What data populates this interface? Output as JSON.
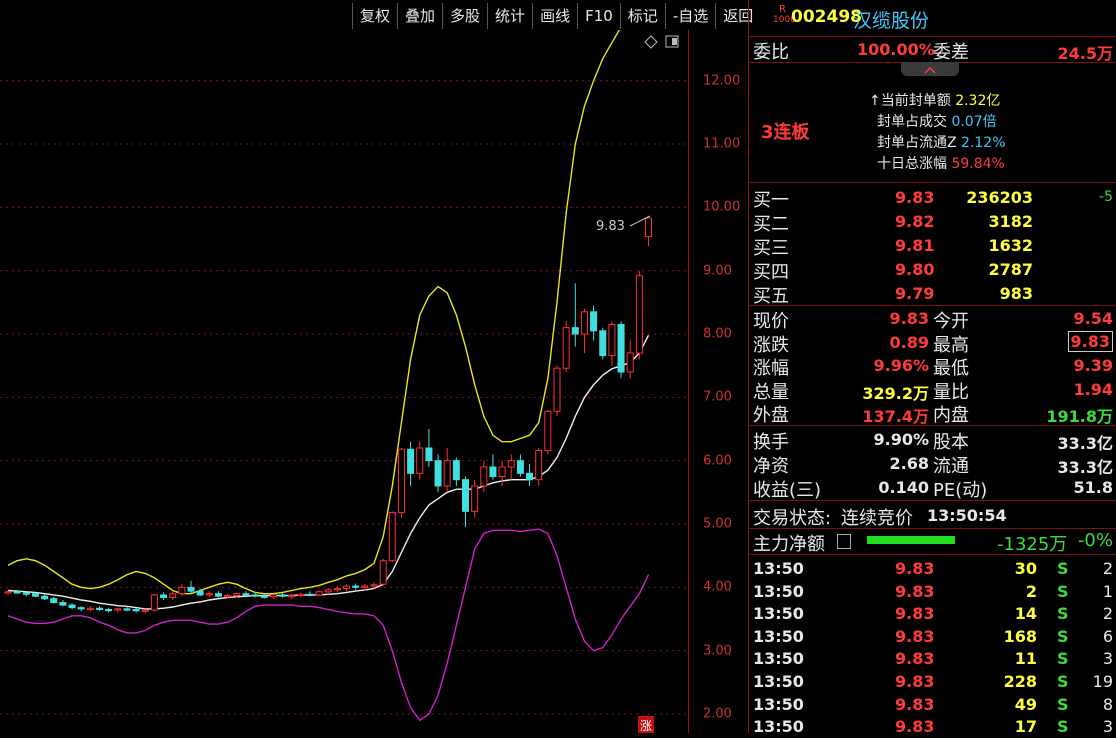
{
  "toolbar": [
    "复权",
    "叠加",
    "多股",
    "统计",
    "画线",
    "F10",
    "标记",
    "-自选",
    "返回"
  ],
  "stock": {
    "badge_top": "R",
    "badge_bottom": "1000",
    "code": "002498",
    "name": "汉缆股份"
  },
  "weibi": {
    "label": "委比",
    "value": "100.00%",
    "diff_label": "委差",
    "diff_value": "24.5万"
  },
  "limit": {
    "tag": "3连板",
    "lines": [
      {
        "label": "↑当前封单额",
        "value": "2.32亿"
      },
      {
        "label": "封单占成交",
        "value": "0.07倍"
      },
      {
        "label": "封单占流通Z",
        "value": "2.12%"
      },
      {
        "label": "十日总涨幅",
        "value": "59.84%"
      }
    ]
  },
  "bids": [
    {
      "label": "买一",
      "price": "9.83",
      "vol": "236203",
      "chg": "-5"
    },
    {
      "label": "买二",
      "price": "9.82",
      "vol": "3182",
      "chg": ""
    },
    {
      "label": "买三",
      "price": "9.81",
      "vol": "1632",
      "chg": ""
    },
    {
      "label": "买四",
      "price": "9.80",
      "vol": "2787",
      "chg": ""
    },
    {
      "label": "买五",
      "price": "9.79",
      "vol": "983",
      "chg": ""
    }
  ],
  "quote": [
    {
      "l1": "现价",
      "v1": "9.83",
      "l2": "今开",
      "v2": "9.54"
    },
    {
      "l1": "涨跌",
      "v1": "0.89",
      "l2": "最高",
      "v2": "9.83"
    },
    {
      "l1": "涨幅",
      "v1": "9.96%",
      "l2": "最低",
      "v2": "9.39"
    },
    {
      "l1": "总量",
      "v1": "329.2万",
      "l2": "量比",
      "v2": "1.94"
    },
    {
      "l1": "外盘",
      "v1": "137.4万",
      "l2": "内盘",
      "v2": "191.8万"
    }
  ],
  "fund": [
    {
      "l1": "换手",
      "v1": "9.90%",
      "l2": "股本",
      "v2": "33.3亿"
    },
    {
      "l1": "净资",
      "v1": "2.68",
      "l2": "流通",
      "v2": "33.3亿"
    },
    {
      "l1": "收益(三)",
      "v1": "0.140",
      "l2": "PE(动)",
      "v2": "51.8"
    }
  ],
  "status": {
    "label": "交易状态:",
    "value": "连续竞价",
    "time": "13:50:54"
  },
  "mainflow": {
    "label": "主力净额",
    "value": "-1325万",
    "pct": "-0%"
  },
  "ticks": [
    {
      "t": "13:50",
      "p": "9.83",
      "v": "30",
      "s": "S",
      "n": "2"
    },
    {
      "t": "13:50",
      "p": "9.83",
      "v": "2",
      "s": "S",
      "n": "1"
    },
    {
      "t": "13:50",
      "p": "9.83",
      "v": "14",
      "s": "S",
      "n": "2"
    },
    {
      "t": "13:50",
      "p": "9.83",
      "v": "168",
      "s": "S",
      "n": "6"
    },
    {
      "t": "13:50",
      "p": "9.83",
      "v": "11",
      "s": "S",
      "n": "3"
    },
    {
      "t": "13:50",
      "p": "9.83",
      "v": "228",
      "s": "S",
      "n": "19"
    },
    {
      "t": "13:50",
      "p": "9.83",
      "v": "49",
      "s": "S",
      "n": "8"
    },
    {
      "t": "13:50",
      "p": "9.83",
      "v": "17",
      "s": "S",
      "n": "3"
    }
  ],
  "chart_data": {
    "type": "candlestick",
    "ylim": [
      1.7,
      12.8
    ],
    "yticks": [
      "12.00",
      "11.00",
      "10.00",
      "9.00",
      "8.00",
      "7.00",
      "6.00",
      "5.00",
      "4.00",
      "3.00",
      "2.00"
    ],
    "last_label": "9.83",
    "bottom_mark": "涨",
    "candles": [
      [
        3.92,
        3.95,
        3.88,
        3.93
      ],
      [
        3.93,
        3.96,
        3.9,
        3.91
      ],
      [
        3.91,
        3.94,
        3.86,
        3.9
      ],
      [
        3.9,
        3.92,
        3.84,
        3.86
      ],
      [
        3.86,
        3.9,
        3.8,
        3.82
      ],
      [
        3.82,
        3.85,
        3.74,
        3.76
      ],
      [
        3.76,
        3.8,
        3.7,
        3.72
      ],
      [
        3.72,
        3.75,
        3.65,
        3.68
      ],
      [
        3.68,
        3.7,
        3.62,
        3.66
      ],
      [
        3.66,
        3.7,
        3.62,
        3.67
      ],
      [
        3.67,
        3.7,
        3.63,
        3.65
      ],
      [
        3.65,
        3.68,
        3.6,
        3.64
      ],
      [
        3.64,
        3.68,
        3.6,
        3.66
      ],
      [
        3.66,
        3.7,
        3.62,
        3.65
      ],
      [
        3.65,
        3.68,
        3.6,
        3.63
      ],
      [
        3.63,
        3.66,
        3.58,
        3.64
      ],
      [
        3.64,
        3.9,
        3.62,
        3.88
      ],
      [
        3.88,
        3.92,
        3.8,
        3.84
      ],
      [
        3.84,
        3.95,
        3.8,
        3.9
      ],
      [
        3.9,
        4.05,
        3.86,
        4.0
      ],
      [
        4.0,
        4.1,
        3.9,
        3.94
      ],
      [
        3.94,
        3.98,
        3.86,
        3.88
      ],
      [
        3.88,
        3.94,
        3.84,
        3.9
      ],
      [
        3.9,
        3.94,
        3.84,
        3.86
      ],
      [
        3.86,
        3.9,
        3.82,
        3.87
      ],
      [
        3.87,
        3.92,
        3.84,
        3.9
      ],
      [
        3.9,
        3.94,
        3.86,
        3.88
      ],
      [
        3.88,
        3.93,
        3.84,
        3.86
      ],
      [
        3.86,
        3.9,
        3.82,
        3.85
      ],
      [
        3.85,
        3.9,
        3.82,
        3.88
      ],
      [
        3.88,
        3.92,
        3.84,
        3.86
      ],
      [
        3.86,
        3.9,
        3.82,
        3.87
      ],
      [
        3.87,
        3.92,
        3.84,
        3.89
      ],
      [
        3.89,
        3.94,
        3.86,
        3.88
      ],
      [
        3.88,
        3.95,
        3.86,
        3.93
      ],
      [
        3.93,
        3.99,
        3.88,
        3.96
      ],
      [
        3.96,
        4.02,
        3.92,
        3.98
      ],
      [
        3.98,
        4.05,
        3.94,
        4.02
      ],
      [
        4.02,
        4.06,
        3.96,
        4.0
      ],
      [
        4.0,
        4.05,
        3.95,
        4.02
      ],
      [
        4.02,
        4.08,
        3.98,
        4.04
      ],
      [
        4.05,
        4.45,
        4.02,
        4.42
      ],
      [
        4.42,
        5.2,
        4.4,
        5.18
      ],
      [
        5.18,
        6.2,
        5.1,
        6.18
      ],
      [
        6.18,
        6.3,
        5.6,
        5.8
      ],
      [
        5.8,
        6.3,
        5.7,
        6.2
      ],
      [
        6.2,
        6.5,
        5.9,
        6.0
      ],
      [
        6.0,
        6.1,
        5.5,
        5.6
      ],
      [
        5.6,
        6.2,
        5.5,
        6.0
      ],
      [
        6.0,
        6.05,
        5.6,
        5.7
      ],
      [
        5.7,
        5.75,
        4.95,
        5.2
      ],
      [
        5.2,
        5.7,
        5.1,
        5.6
      ],
      [
        5.6,
        6.0,
        5.5,
        5.9
      ],
      [
        5.9,
        6.1,
        5.7,
        5.75
      ],
      [
        5.75,
        6.0,
        5.6,
        5.9
      ],
      [
        5.9,
        6.1,
        5.7,
        6.0
      ],
      [
        6.0,
        6.1,
        5.75,
        5.8
      ],
      [
        5.8,
        5.95,
        5.6,
        5.7
      ],
      [
        5.7,
        6.2,
        5.6,
        6.16
      ],
      [
        6.16,
        6.8,
        6.1,
        6.78
      ],
      [
        6.78,
        7.5,
        6.7,
        7.46
      ],
      [
        7.46,
        8.2,
        7.4,
        8.1
      ],
      [
        8.1,
        8.8,
        7.8,
        8.0
      ],
      [
        8.0,
        8.4,
        7.7,
        8.35
      ],
      [
        8.35,
        8.45,
        7.9,
        8.05
      ],
      [
        8.05,
        8.1,
        7.6,
        7.66
      ],
      [
        7.66,
        8.2,
        7.5,
        8.15
      ],
      [
        8.15,
        8.2,
        7.3,
        7.4
      ],
      [
        7.4,
        7.9,
        7.3,
        7.7
      ],
      [
        7.7,
        9.0,
        7.6,
        8.92
      ],
      [
        9.54,
        9.83,
        9.39,
        9.83
      ]
    ],
    "ma": [
      3.95,
      3.94,
      3.93,
      3.92,
      3.9,
      3.88,
      3.86,
      3.83,
      3.8,
      3.78,
      3.75,
      3.73,
      3.71,
      3.7,
      3.68,
      3.66,
      3.66,
      3.67,
      3.69,
      3.72,
      3.75,
      3.77,
      3.8,
      3.82,
      3.84,
      3.85,
      3.86,
      3.87,
      3.87,
      3.87,
      3.87,
      3.87,
      3.88,
      3.88,
      3.88,
      3.89,
      3.9,
      3.92,
      3.94,
      3.96,
      3.98,
      4.05,
      4.25,
      4.55,
      4.85,
      5.1,
      5.3,
      5.4,
      5.5,
      5.55,
      5.55,
      5.55,
      5.6,
      5.65,
      5.68,
      5.7,
      5.7,
      5.7,
      5.75,
      5.85,
      6.05,
      6.35,
      6.7,
      7.0,
      7.2,
      7.35,
      7.45,
      7.5,
      7.55,
      7.7,
      7.98
    ],
    "upper": [
      4.35,
      4.42,
      4.45,
      4.42,
      4.35,
      4.25,
      4.15,
      4.05,
      4.0,
      3.98,
      4.0,
      4.05,
      4.12,
      4.2,
      4.25,
      4.22,
      4.15,
      4.05,
      3.95,
      3.9,
      3.9,
      3.95,
      4.0,
      4.05,
      4.08,
      4.05,
      3.98,
      3.92,
      3.9,
      3.9,
      3.92,
      3.95,
      3.98,
      4.0,
      4.03,
      4.08,
      4.12,
      4.18,
      4.22,
      4.28,
      4.38,
      4.8,
      5.6,
      6.6,
      7.6,
      8.3,
      8.6,
      8.75,
      8.65,
      8.3,
      7.8,
      7.2,
      6.7,
      6.4,
      6.3,
      6.3,
      6.35,
      6.4,
      6.6,
      7.3,
      8.5,
      9.9,
      11.0,
      11.6,
      12.0,
      12.35,
      12.6,
      12.85,
      13.05,
      13.25,
      13.42
    ],
    "lower": [
      3.55,
      3.5,
      3.45,
      3.43,
      3.43,
      3.45,
      3.5,
      3.55,
      3.55,
      3.52,
      3.45,
      3.4,
      3.33,
      3.28,
      3.28,
      3.32,
      3.4,
      3.45,
      3.48,
      3.48,
      3.48,
      3.45,
      3.42,
      3.42,
      3.45,
      3.52,
      3.62,
      3.7,
      3.72,
      3.72,
      3.72,
      3.72,
      3.7,
      3.7,
      3.68,
      3.65,
      3.62,
      3.6,
      3.58,
      3.58,
      3.55,
      3.4,
      3.0,
      2.5,
      2.1,
      1.9,
      2.0,
      2.3,
      2.8,
      3.4,
      4.0,
      4.6,
      4.85,
      4.9,
      4.9,
      4.9,
      4.88,
      4.9,
      4.92,
      4.85,
      4.5,
      4.0,
      3.5,
      3.15,
      3.0,
      3.05,
      3.25,
      3.5,
      3.7,
      3.9,
      4.2
    ]
  }
}
